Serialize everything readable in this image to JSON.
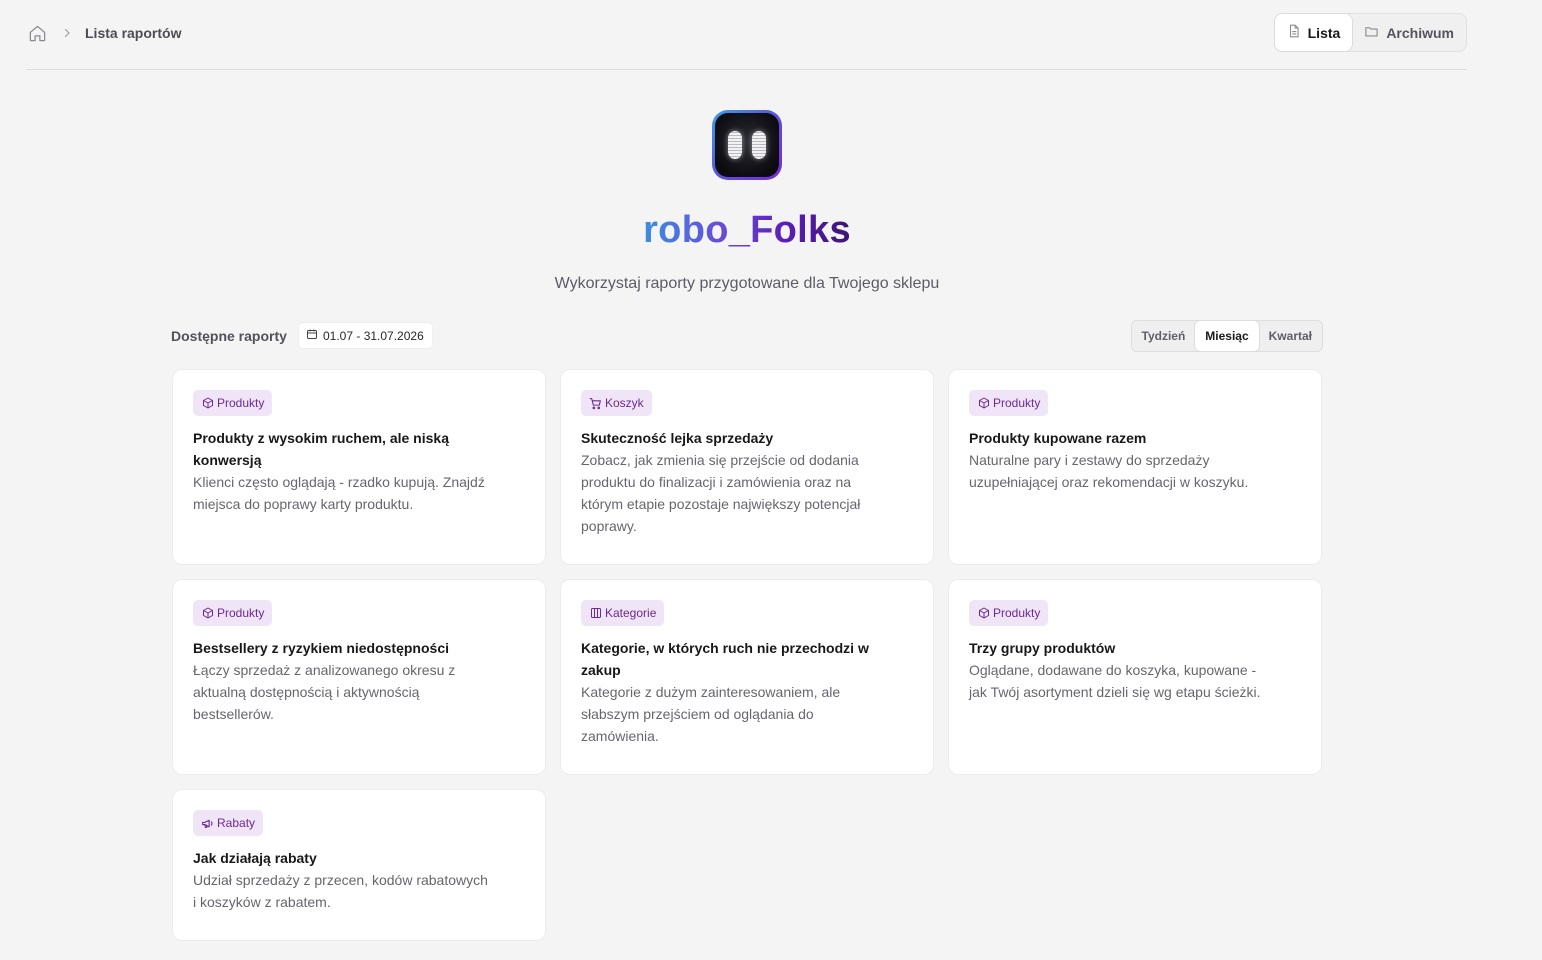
{
  "header": {
    "breadcrumb_current": "Lista raportów",
    "view_tabs": [
      {
        "label": "Lista",
        "active": true,
        "icon": "document-icon"
      },
      {
        "label": "Archiwum",
        "active": false,
        "icon": "folder-icon"
      }
    ]
  },
  "hero": {
    "brand_name": "robo_Folks",
    "subtitle": "Wykorzystaj raporty przygotowane dla Twojego sklepu"
  },
  "filters": {
    "available_label": "Dostępne raporty",
    "date_range": "01.07 - 31.07.2026",
    "periods": [
      {
        "label": "Tydzień",
        "active": false
      },
      {
        "label": "Miesiąc",
        "active": true
      },
      {
        "label": "Kwartał",
        "active": false
      }
    ]
  },
  "reports": [
    {
      "tag": "Produkty",
      "icon": "box-icon",
      "title": "Produkty z wysokim ruchem, ale niską konwersją",
      "description": "Klienci często oglądają - rzadko kupują. Znajdź miejsca do poprawy karty produktu."
    },
    {
      "tag": "Koszyk",
      "icon": "cart-icon",
      "title": "Skuteczność lejka sprzedaży",
      "description": "Zobacz, jak zmienia się przejście od dodania produktu do finalizacji i zamówienia oraz na którym etapie pozostaje największy potencjał poprawy."
    },
    {
      "tag": "Produkty",
      "icon": "box-icon",
      "title": "Produkty kupowane razem",
      "description": "Naturalne pary i zestawy do sprzedaży uzupełniającej oraz rekomendacji w koszyku."
    },
    {
      "tag": "Produkty",
      "icon": "box-icon",
      "title": "Bestsellery z ryzykiem niedostępności",
      "description": "Łączy sprzedaż z analizowanego okresu z aktualną dostępnością i aktywnością bestsellerów."
    },
    {
      "tag": "Kategorie",
      "icon": "columns-icon",
      "title": "Kategorie, w których ruch nie przechodzi w zakup",
      "description": "Kategorie z dużym zainteresowaniem, ale słabszym przejściem od oglądania do zamówienia."
    },
    {
      "tag": "Produkty",
      "icon": "box-icon",
      "title": "Trzy grupy produktów",
      "description": "Oglądane, dodawane do koszyka, kupowane - jak Twój asortyment dzieli się wg etapu ścieżki."
    },
    {
      "tag": "Rabaty",
      "icon": "megaphone-icon",
      "title": "Jak działają rabaty",
      "description": "Udział sprzedaży z przecen, kodów rabatowych i koszyków z rabatem."
    }
  ]
}
